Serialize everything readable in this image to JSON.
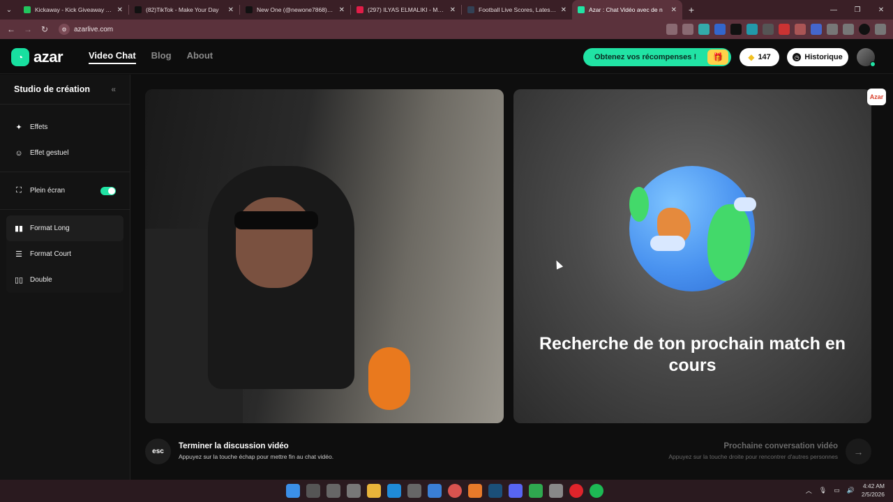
{
  "browser": {
    "tabs": [
      {
        "title": "Kickaway - Kick Giveaway Tool",
        "color": "#22c55e"
      },
      {
        "title": "(82)TikTok - Make Your Day",
        "color": "#111111"
      },
      {
        "title": "New One (@newone7868) | TikTok",
        "color": "#111111"
      },
      {
        "title": "(297) ILYAS ELMALIKI - Moul ch",
        "color": "#e11d48"
      },
      {
        "title": "Football Live Scores, Latest Foo",
        "color": "#334155"
      },
      {
        "title": "Azar : Chat Vidéo avec de n",
        "color": "#21e3a4",
        "active": true
      }
    ],
    "url": "azarlive.com"
  },
  "header": {
    "logo_text": "azar",
    "nav": [
      {
        "label": "Video Chat",
        "active": true
      },
      {
        "label": "Blog"
      },
      {
        "label": "About"
      }
    ],
    "reward_label": "Obtenez vos récompenses !",
    "gems_count": "147",
    "history_label": "Historique"
  },
  "sidebar": {
    "title": "Studio de création",
    "items": [
      {
        "label": "Effets",
        "icon": "wand-icon"
      },
      {
        "label": "Effet gestuel",
        "icon": "smile-icon"
      }
    ],
    "fullscreen_label": "Plein écran",
    "fullscreen_on": true,
    "formats": [
      {
        "label": "Format Long",
        "icon": "split-vertical-icon",
        "selected": true
      },
      {
        "label": "Format Court",
        "icon": "split-horizontal-icon"
      },
      {
        "label": "Double",
        "icon": "double-icon"
      }
    ]
  },
  "main": {
    "search_text": "Recherche de ton prochain match en cours",
    "azar_badge": "Azar"
  },
  "controls": {
    "esc_label": "esc",
    "end_title": "Terminer la discussion vidéo",
    "end_hint": "Appuyez sur la touche échap pour mettre fin au chat vidéo.",
    "next_title": "Prochaine conversation vidéo",
    "next_hint": "Appuyez sur la touche droite pour rencontrer d'autres personnes"
  },
  "taskbar": {
    "time": "4:42 AM",
    "date": "2/5/2026"
  }
}
